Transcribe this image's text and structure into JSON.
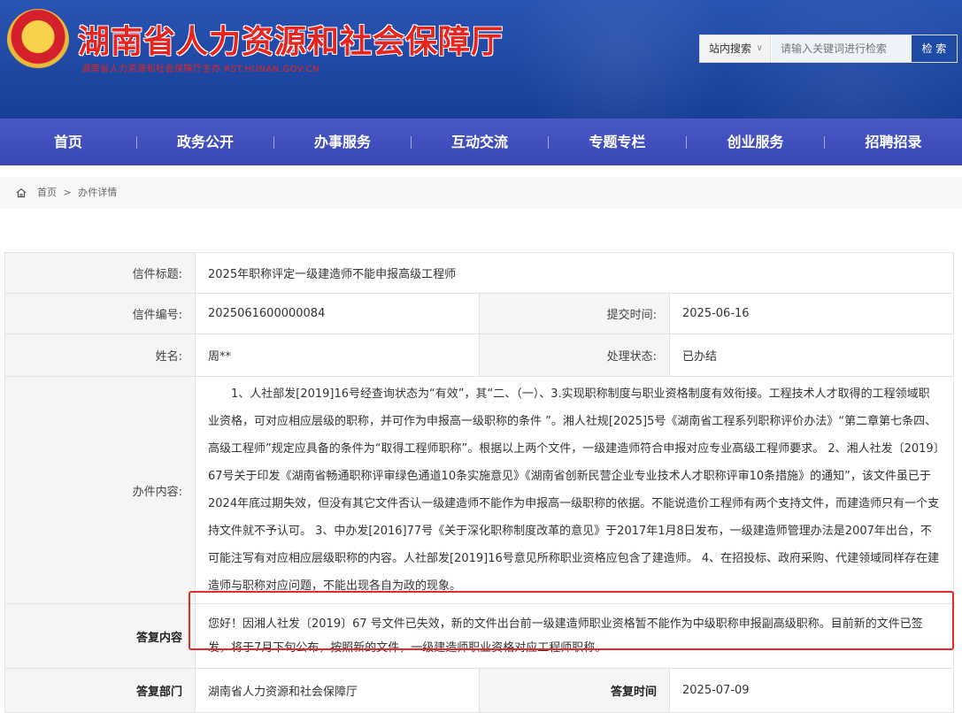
{
  "header": {
    "title": "湖南省人力资源和社会保障厅",
    "subtitle": "湖南省人力资源和社会保障厅主办   RST.HUNAN.GOV.CN"
  },
  "search": {
    "scope": "站内搜索",
    "placeholder": "请输入关键词进行检索",
    "button": "检 索"
  },
  "nav": {
    "items": [
      "首页",
      "政务公开",
      "办事服务",
      "互动交流",
      "专题专栏",
      "创业服务",
      "招聘招录"
    ]
  },
  "breadcrumb": {
    "home": "首页",
    "sep": ">",
    "current": "办件详情"
  },
  "detail": {
    "title_label": "信件标题:",
    "title_value": "2025年职称评定一级建造师不能申报高级工程师",
    "number_label": "信件编号:",
    "number_value": "2025061600000084",
    "submit_label": "提交时间:",
    "submit_value": "2025-06-16",
    "name_label": "姓名:",
    "name_value": "周**",
    "status_label": "处理状态:",
    "status_value": "已办结",
    "content_label": "办件内容:",
    "content_value": "1、人社部发[2019]16号经查询状态为“有效”，其“二、（一）、3.实现职称制度与职业资格制度有效衔接。工程技术人才取得的工程领域职业资格，可对应相应层级的职称，并可作为申报高一级职称的条件 ”。湘人社规[2025]5号《湖南省工程系列职称评价办法》“第二章第七条四、高级工程师”规定应具备的条件为“取得工程师职称”。根据以上两个文件，一级建造师符合申报对应专业高级工程师要求。 2、湘人社发〔2019〕67号关于印发《湖南省畅通职称评审绿色通道10条实施意见》《湖南省创新民营企业专业技术人才职称评审10条措施》的通知”，该文件虽已于2024年底过期失效，但没有其它文件否认一级建造师不能作为申报高一级职称的依据。不能说造价工程师有两个支持文件，而建造师只有一个支持文件就不予认可。 3、中办发[2016]77号《关于深化职称制度改革的意见》于2017年1月8日发布，一级建造师管理办法是2007年出台，不可能注写有对应相应层级职称的内容。人社部发[2019]16号意见所称职业资格应包含了建造师。 4、在招投标、政府采购、代建领域同样存在建造师与职称对应问题，不能出现各自为政的现象。",
    "reply_label": "答复内容",
    "reply_value": "您好！因湘人社发〔2019〕67 号文件已失效，新的文件出台前一级建造师职业资格暂不能作为中级职称申报副高级职称。目前新的文件已签发，将于7月下旬公布，按照新的文件，一级建造师职业资格对应工程师职称。",
    "dept_label": "答复部门",
    "dept_value": "湖南省人力资源和社会保障厅",
    "reply_time_label": "答复时间",
    "reply_time_value": "2025-07-09"
  },
  "colors": {
    "header_bg": "#1c4aa8",
    "nav_bg": "#3f4fc1",
    "title_red": "#e5251f",
    "highlight_border": "#e02c2c"
  }
}
